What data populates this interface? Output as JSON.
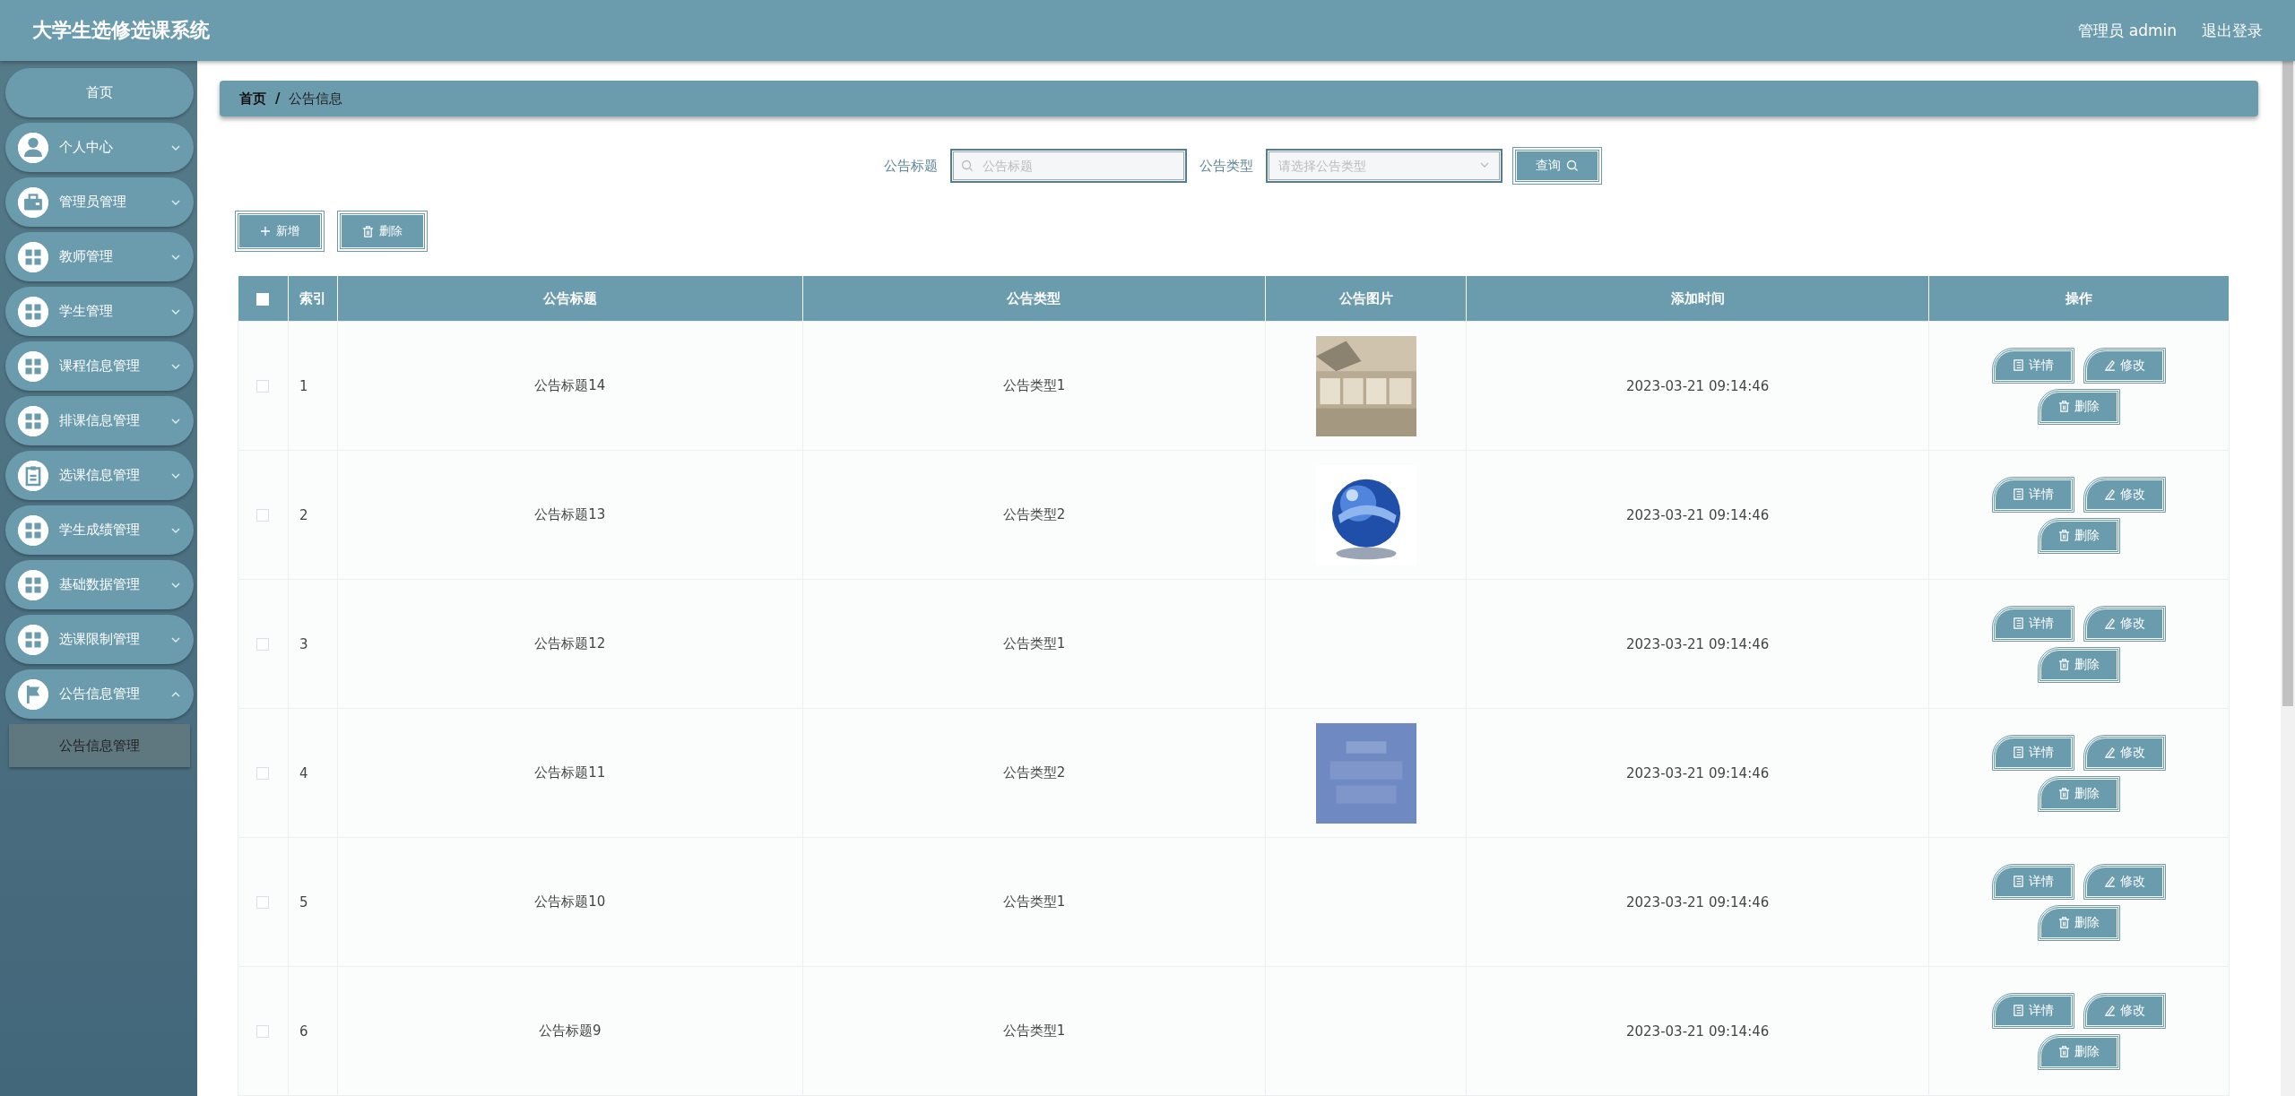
{
  "header": {
    "title": "大学生选修选课系统",
    "user": "管理员 admin",
    "logout": "退出登录"
  },
  "sidebar": {
    "items": [
      {
        "label": "首页"
      },
      {
        "label": "个人中心",
        "expanded": false
      },
      {
        "label": "管理员管理",
        "expanded": false
      },
      {
        "label": "教师管理",
        "expanded": false
      },
      {
        "label": "学生管理",
        "expanded": false
      },
      {
        "label": "课程信息管理",
        "expanded": false
      },
      {
        "label": "排课信息管理",
        "expanded": false
      },
      {
        "label": "选课信息管理",
        "expanded": false
      },
      {
        "label": "学生成绩管理",
        "expanded": false
      },
      {
        "label": "基础数据管理",
        "expanded": false
      },
      {
        "label": "选课限制管理",
        "expanded": false
      },
      {
        "label": "公告信息管理",
        "expanded": true,
        "children": [
          {
            "label": "公告信息管理",
            "selected": true
          }
        ]
      }
    ]
  },
  "breadcrumb": [
    "首页",
    "/",
    "公告信息"
  ],
  "search": {
    "title_label": "公告标题",
    "title_placeholder": "公告标题",
    "type_label": "公告类型",
    "type_placeholder": "请选择公告类型",
    "button": "查询"
  },
  "toolbar": [
    "新增",
    "删除"
  ],
  "table": {
    "select_all_checked": false,
    "columns": [
      "索引",
      "公告标题",
      "公告类型",
      "公告图片",
      "添加时间",
      "操作"
    ],
    "rows": [
      {
        "checked": false,
        "index": "1",
        "title": "公告标题14",
        "type": "公告类型1",
        "picture": true,
        "time": "2023-03-21 09:14:46",
        "actions": [
          "详情",
          "修改",
          "删除"
        ]
      },
      {
        "checked": false,
        "index": "2",
        "title": "公告标题13",
        "type": "公告类型2",
        "picture": true,
        "time": "2023-03-21 09:14:46",
        "actions": [
          "详情",
          "修改",
          "删除"
        ]
      },
      {
        "checked": false,
        "index": "3",
        "title": "公告标题12",
        "type": "公告类型1",
        "picture": false,
        "time": "2023-03-21 09:14:46",
        "actions": [
          "详情",
          "修改",
          "删除"
        ]
      },
      {
        "checked": false,
        "index": "4",
        "title": "公告标题11",
        "type": "公告类型2",
        "picture": true,
        "time": "2023-03-21 09:14:46",
        "actions": [
          "详情",
          "修改",
          "删除"
        ]
      },
      {
        "checked": false,
        "index": "5",
        "title": "公告标题10",
        "type": "公告类型1",
        "picture": false,
        "time": "2023-03-21 09:14:46",
        "actions": [
          "详情",
          "修改",
          "删除"
        ]
      },
      {
        "checked": false,
        "index": "6",
        "title": "公告标题9",
        "type": "公告类型1",
        "picture": false,
        "time": "2023-03-21 09:14:46",
        "actions": [
          "详情",
          "修改",
          "删除"
        ]
      }
    ]
  }
}
